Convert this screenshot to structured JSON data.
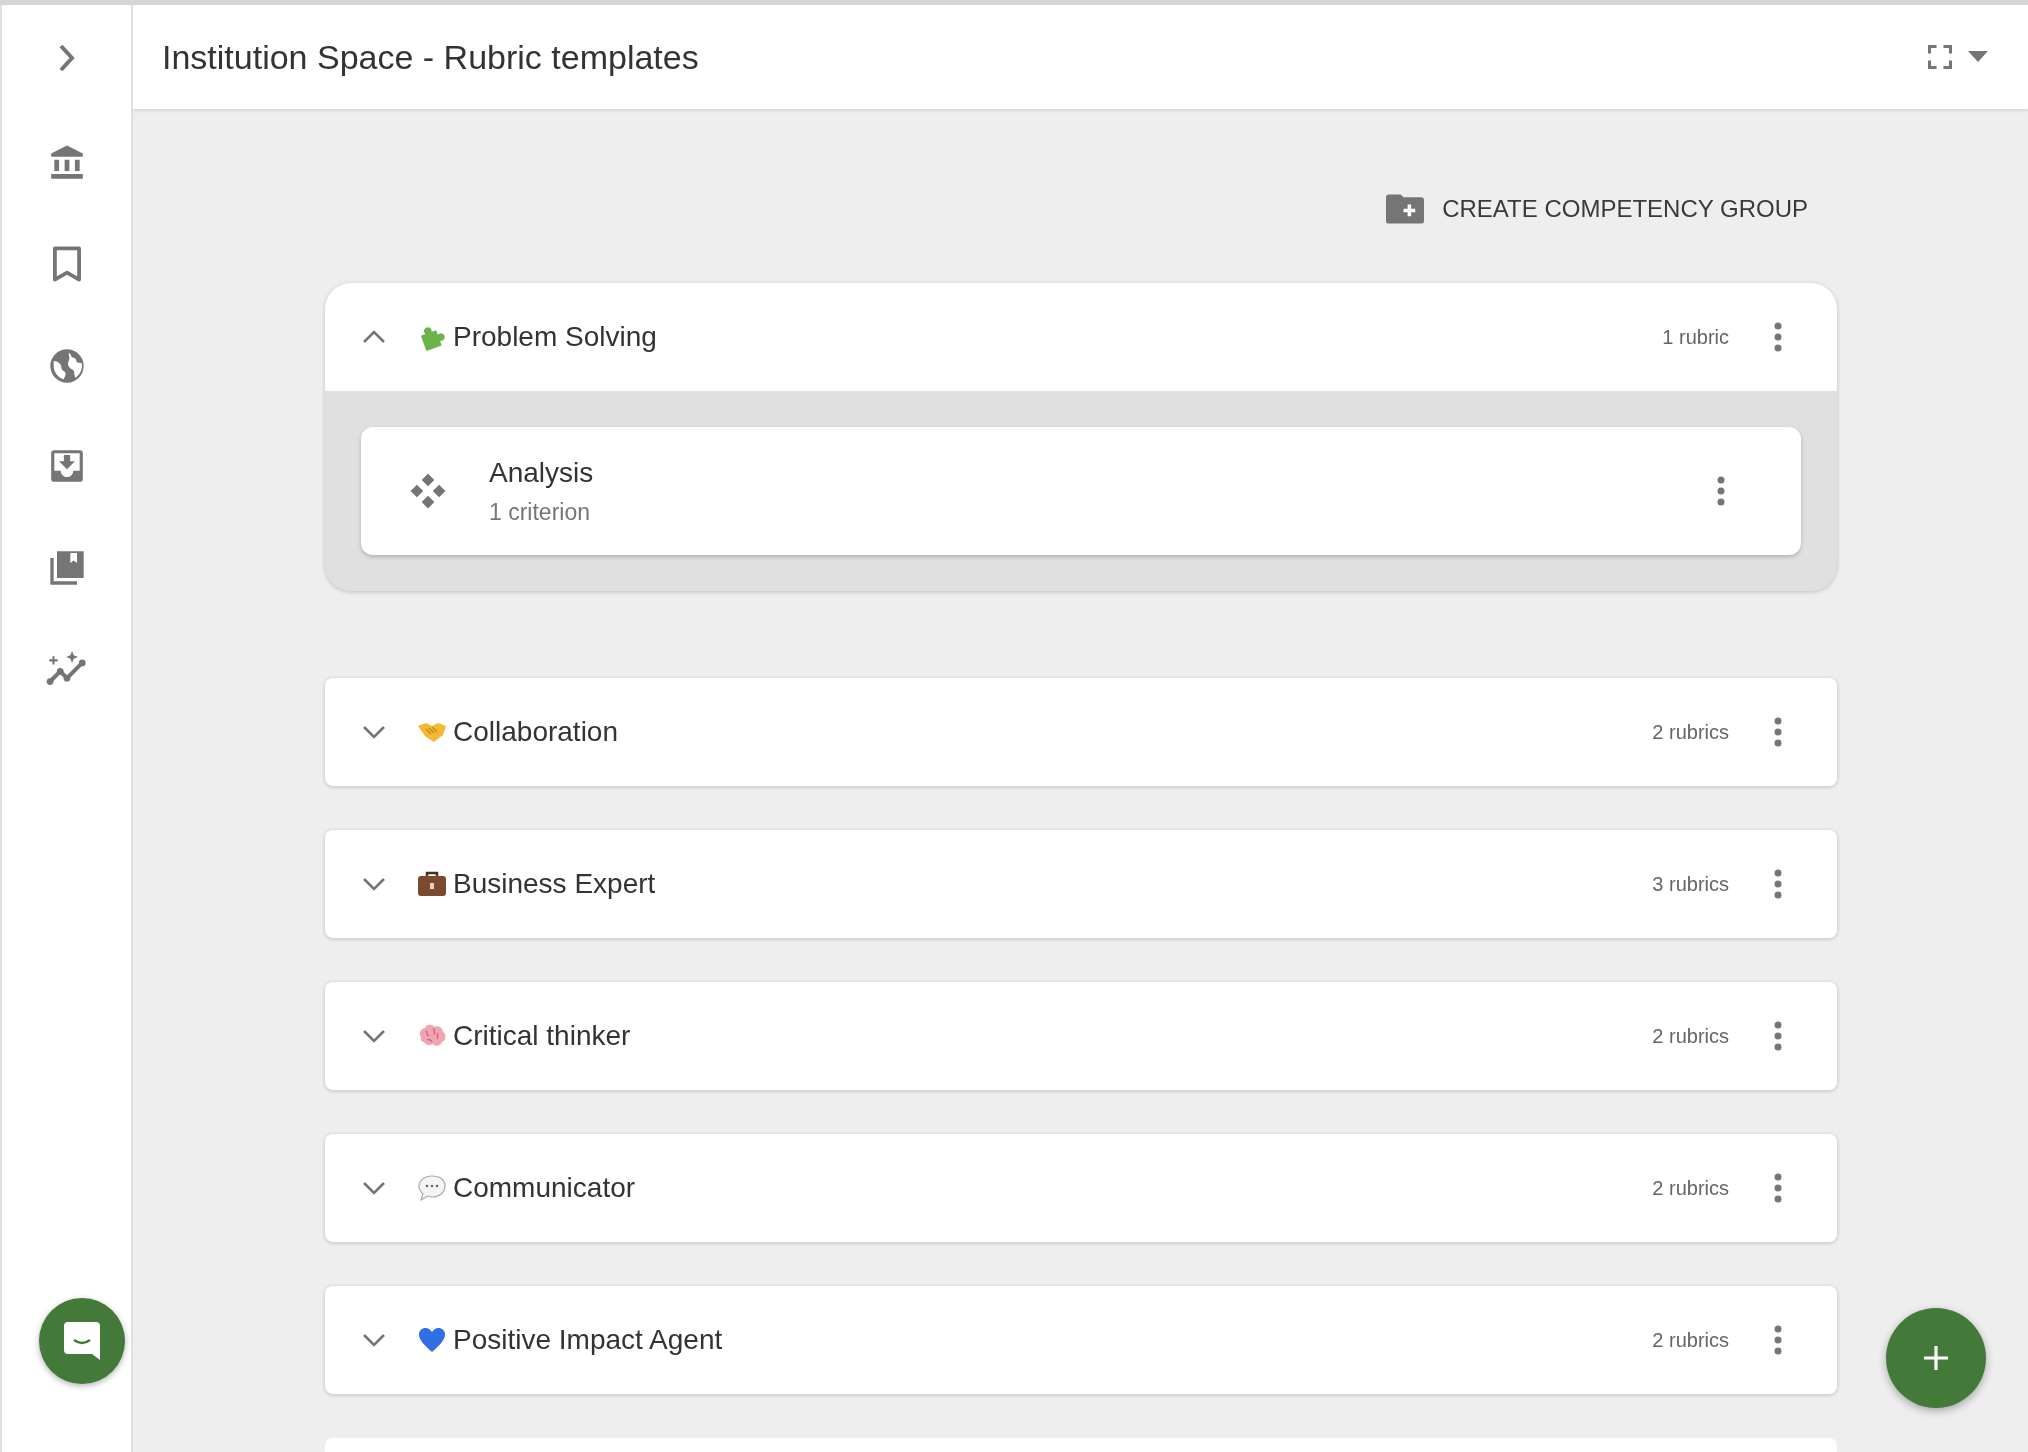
{
  "header": {
    "title": "Institution Space - Rubric templates"
  },
  "create_button": {
    "label": "CREATE COMPETENCY GROUP"
  },
  "groups": [
    {
      "kind": "puzzle",
      "name": "Problem Solving",
      "count": "1 rubric",
      "expanded": true,
      "rubrics": [
        {
          "name": "Analysis",
          "subtitle": "1 criterion"
        }
      ]
    },
    {
      "kind": "handshake",
      "name": "Collaboration",
      "count": "2 rubrics",
      "expanded": false
    },
    {
      "kind": "briefcase",
      "name": "Business Expert",
      "count": "3 rubrics",
      "expanded": false
    },
    {
      "kind": "brain",
      "name": "Critical thinker",
      "count": "2 rubrics",
      "expanded": false
    },
    {
      "kind": "speech",
      "name": "Communicator",
      "count": "2 rubrics",
      "expanded": false
    },
    {
      "kind": "heart",
      "name": "Positive Impact Agent",
      "count": "2 rubrics",
      "expanded": false
    }
  ]
}
